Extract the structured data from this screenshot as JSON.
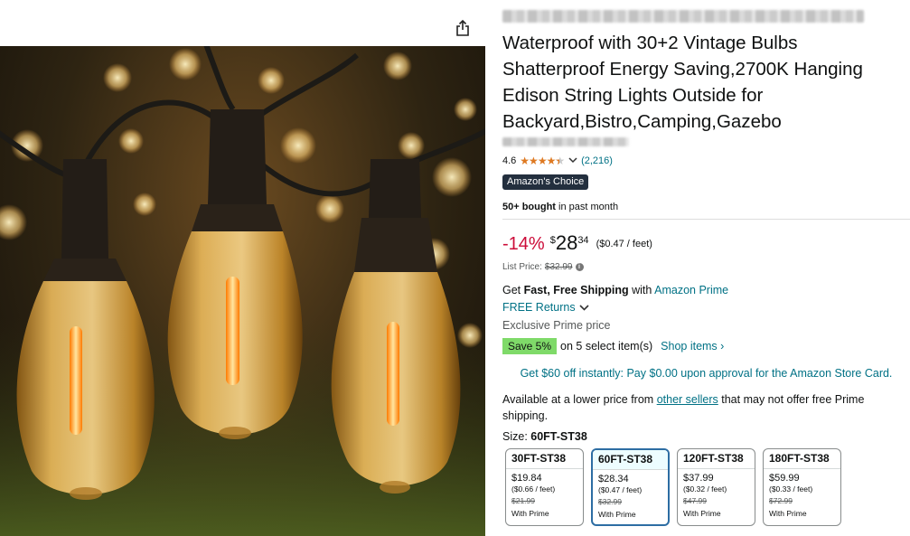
{
  "product": {
    "title": "Waterproof with 30+2 Vintage Bulbs Shatterproof Energy Saving,2700K Hanging Edison String Lights Outside for Backyard,Bistro,Camping,Gazebo",
    "rating": "4.6",
    "stars_icon": "star-rating-icon",
    "stars_value": 4.5,
    "review_count": "(2,216)",
    "badge": "Amazon's Choice",
    "bought_bold": "50+ bought",
    "bought_rest": " in past month"
  },
  "pricing": {
    "discount": "-14%",
    "currency": "$",
    "whole": "28",
    "fraction": "34",
    "per_unit": "($0.47 / feet)",
    "list_price_label": "List Price:",
    "list_price": "$32.99"
  },
  "shipping": {
    "prefix": "Get ",
    "bold": "Fast, Free Shipping",
    "middle": " with ",
    "link": "Amazon Prime",
    "returns": "FREE Returns",
    "exclusive": "Exclusive Prime price"
  },
  "promo": {
    "save_badge": "Save 5%",
    "save_text": "on 5 select item(s)",
    "shop_link": "Shop items ›",
    "card_offer": "Get $60 off instantly: Pay $0.00 upon approval for the Amazon Store Card."
  },
  "availability": {
    "prefix": "Available at a lower price from ",
    "link": "other sellers",
    "suffix": " that may not offer free Prime shipping."
  },
  "size": {
    "label": "Size: ",
    "selected": "60FT-ST38",
    "options": [
      {
        "name": "30FT-ST38",
        "price": "$19.84",
        "unit": "($0.66 / feet)",
        "list": "$21.99",
        "prime": "With Prime"
      },
      {
        "name": "60FT-ST38",
        "price": "$28.34",
        "unit": "($0.47 / feet)",
        "list": "$32.99",
        "prime": "With Prime"
      },
      {
        "name": "120FT-ST38",
        "price": "$37.99",
        "unit": "($0.32 / feet)",
        "list": "$47.99",
        "prime": "With Prime"
      },
      {
        "name": "180FT-ST38",
        "price": "$59.99",
        "unit": "($0.33 / feet)",
        "list": "$72.99",
        "prime": "With Prime"
      }
    ]
  },
  "colors": {
    "discount": "#cc0c39",
    "link": "#007185",
    "star": "#de7921",
    "badge_bg": "#232f3e",
    "save_bg": "#7fda69",
    "selected_border": "#2d6da3"
  },
  "icons": {
    "share": "share-icon",
    "info": "info-icon",
    "chevron": "chevron-down-icon"
  }
}
